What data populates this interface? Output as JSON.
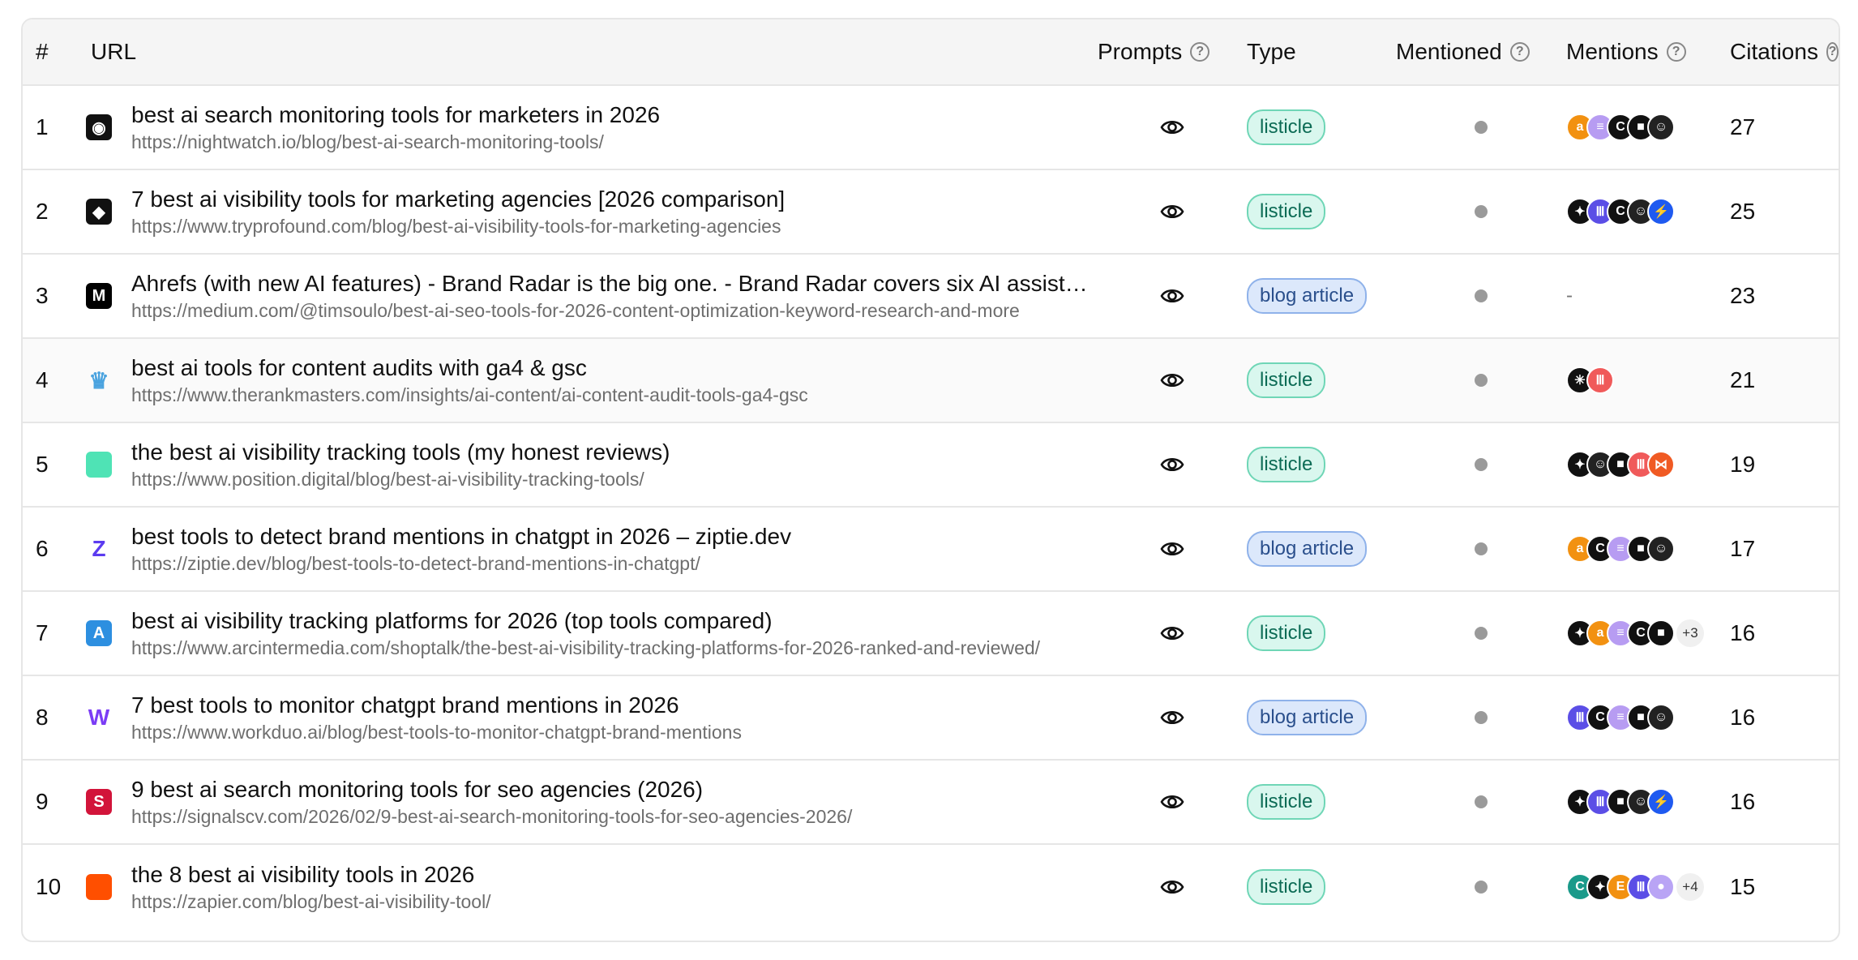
{
  "columns": {
    "num": "#",
    "url": "URL",
    "prompts": "Prompts",
    "type": "Type",
    "mentioned": "Mentioned",
    "mentions": "Mentions",
    "citations": "Citations"
  },
  "rows": [
    {
      "num": "1",
      "title": "best ai search monitoring tools for marketers in 2026",
      "link": "https://nightwatch.io/blog/best-ai-search-monitoring-tools/",
      "type": "listicle",
      "citations": "27",
      "favicon": "owl-logo-icon",
      "favicon_color": "#111111",
      "mentions": [
        "orange-a",
        "purple-bars",
        "black-c",
        "black-square",
        "mono-face"
      ],
      "more": ""
    },
    {
      "num": "2",
      "title": "7 best ai visibility tools for marketing agencies [2026 comparison]",
      "link": "https://www.tryprofound.com/blog/best-ai-visibility-tools-for-marketing-agencies",
      "type": "listicle",
      "citations": "25",
      "favicon": "profound-logo-icon",
      "favicon_color": "#111111",
      "mentions": [
        "black-star",
        "purple-columns",
        "black-c",
        "mono-face",
        "blue-bolt"
      ],
      "more": ""
    },
    {
      "num": "3",
      "title": "Ahrefs (with new AI features) - Brand Radar is the big one. - Brand Radar covers six AI assistants",
      "link": "https://medium.com/@timsoulo/best-ai-seo-tools-for-2026-content-optimization-keyword-research-and-more",
      "type": "blog article",
      "citations": "23",
      "favicon": "medium-logo-icon",
      "favicon_color": "#000000",
      "mentions": [],
      "more": "",
      "mentions_empty": "-"
    },
    {
      "num": "4",
      "title": "best ai tools for content audits with ga4 & gsc",
      "link": "https://www.therankmasters.com/insights/ai-content/ai-content-audit-tools-ga4-gsc",
      "type": "listicle",
      "citations": "21",
      "favicon": "crown-logo-icon",
      "favicon_color": "#4aa3df",
      "mentions": [
        "black-spark",
        "red-columns"
      ],
      "more": ""
    },
    {
      "num": "5",
      "title": "the best ai visibility tracking tools (my honest reviews)",
      "link": "https://www.position.digital/blog/best-ai-visibility-tracking-tools/",
      "type": "listicle",
      "citations": "19",
      "favicon": "mint-square-icon",
      "favicon_color": "#4fe3b5",
      "mentions": [
        "black-star",
        "mono-face",
        "black-square",
        "red-columns",
        "orange-bowtie"
      ],
      "more": ""
    },
    {
      "num": "6",
      "title": "best tools to detect brand mentions in chatgpt in 2026 – ziptie.dev",
      "link": "https://ziptie.dev/blog/best-tools-to-detect-brand-mentions-in-chatgpt/",
      "type": "blog article",
      "citations": "17",
      "favicon": "ziptie-logo-icon",
      "favicon_color": "#5b3bf0",
      "mentions": [
        "orange-a",
        "black-c",
        "purple-bars",
        "black-square",
        "mono-face"
      ],
      "more": ""
    },
    {
      "num": "7",
      "title": "best ai visibility tracking platforms for 2026 (top tools compared)",
      "link": "https://www.arcintermedia.com/shoptalk/the-best-ai-visibility-tracking-platforms-for-2026-ranked-and-reviewed/",
      "type": "listicle",
      "citations": "16",
      "favicon": "arc-logo-icon",
      "favicon_color": "#2d8fe0",
      "mentions": [
        "black-star",
        "orange-a",
        "purple-bars",
        "black-c",
        "black-square"
      ],
      "more": "+3"
    },
    {
      "num": "8",
      "title": "7 best tools to monitor chatgpt brand mentions in 2026",
      "link": "https://www.workduo.ai/blog/best-tools-to-monitor-chatgpt-brand-mentions",
      "type": "blog article",
      "citations": "16",
      "favicon": "workduo-logo-icon",
      "favicon_color": "#7b3cf5",
      "mentions": [
        "purple-columns",
        "black-c",
        "purple-bars",
        "black-square",
        "mono-face"
      ],
      "more": ""
    },
    {
      "num": "9",
      "title": "9 best ai search monitoring tools for seo agencies (2026)",
      "link": "https://signalscv.com/2026/02/9-best-ai-search-monitoring-tools-for-seo-agencies-2026/",
      "type": "listicle",
      "citations": "16",
      "favicon": "signal-logo-icon",
      "favicon_color": "#d2143a",
      "mentions": [
        "black-star",
        "purple-columns",
        "black-square",
        "mono-face",
        "blue-bolt"
      ],
      "more": ""
    },
    {
      "num": "10",
      "title": "the 8 best ai visibility tools in 2026",
      "link": "https://zapier.com/blog/best-ai-visibility-tool/",
      "type": "listicle",
      "citations": "15",
      "favicon": "zapier-square-icon",
      "favicon_color": "#ff4f00",
      "mentions": [
        "teal-c",
        "black-star",
        "orange-e",
        "purple-columns",
        "lilac-bubble"
      ],
      "more": "+4"
    }
  ],
  "mention_styles": {
    "orange-a": {
      "bg": "#f29111",
      "glyph": "a"
    },
    "purple-bars": {
      "bg": "#b79cf2",
      "glyph": "≡"
    },
    "black-c": {
      "bg": "#111111",
      "glyph": "C"
    },
    "black-square": {
      "bg": "#111111",
      "glyph": "■"
    },
    "mono-face": {
      "bg": "#222222",
      "glyph": "☺"
    },
    "black-star": {
      "bg": "#111111",
      "glyph": "✦"
    },
    "purple-columns": {
      "bg": "#5b4ee6",
      "glyph": "Ⅲ"
    },
    "blue-bolt": {
      "bg": "#1f5af0",
      "glyph": "⚡"
    },
    "black-spark": {
      "bg": "#111111",
      "glyph": "✳"
    },
    "red-columns": {
      "bg": "#f05a5a",
      "glyph": "Ⅲ"
    },
    "orange-bowtie": {
      "bg": "#f05a23",
      "glyph": "⋈"
    },
    "teal-c": {
      "bg": "#1a9a8a",
      "glyph": "C"
    },
    "orange-e": {
      "bg": "#f29111",
      "glyph": "E"
    },
    "lilac-bubble": {
      "bg": "#b9a4f5",
      "glyph": "●"
    }
  }
}
